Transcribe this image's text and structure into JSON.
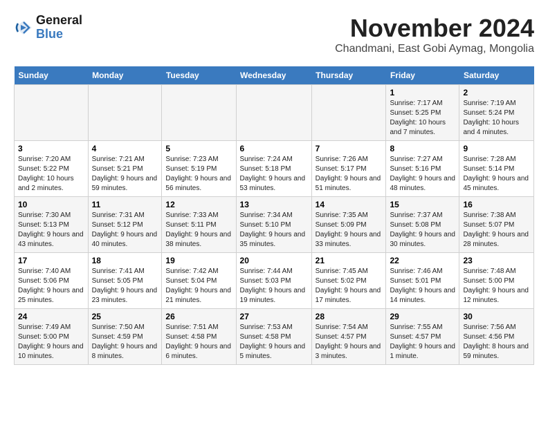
{
  "logo": {
    "line1": "General",
    "line2": "Blue"
  },
  "title": "November 2024",
  "location": "Chandmani, East Gobi Aymag, Mongolia",
  "days_of_week": [
    "Sunday",
    "Monday",
    "Tuesday",
    "Wednesday",
    "Thursday",
    "Friday",
    "Saturday"
  ],
  "weeks": [
    [
      {
        "day": "",
        "sunrise": "",
        "sunset": "",
        "daylight": ""
      },
      {
        "day": "",
        "sunrise": "",
        "sunset": "",
        "daylight": ""
      },
      {
        "day": "",
        "sunrise": "",
        "sunset": "",
        "daylight": ""
      },
      {
        "day": "",
        "sunrise": "",
        "sunset": "",
        "daylight": ""
      },
      {
        "day": "",
        "sunrise": "",
        "sunset": "",
        "daylight": ""
      },
      {
        "day": "1",
        "sunrise": "Sunrise: 7:17 AM",
        "sunset": "Sunset: 5:25 PM",
        "daylight": "Daylight: 10 hours and 7 minutes."
      },
      {
        "day": "2",
        "sunrise": "Sunrise: 7:19 AM",
        "sunset": "Sunset: 5:24 PM",
        "daylight": "Daylight: 10 hours and 4 minutes."
      }
    ],
    [
      {
        "day": "3",
        "sunrise": "Sunrise: 7:20 AM",
        "sunset": "Sunset: 5:22 PM",
        "daylight": "Daylight: 10 hours and 2 minutes."
      },
      {
        "day": "4",
        "sunrise": "Sunrise: 7:21 AM",
        "sunset": "Sunset: 5:21 PM",
        "daylight": "Daylight: 9 hours and 59 minutes."
      },
      {
        "day": "5",
        "sunrise": "Sunrise: 7:23 AM",
        "sunset": "Sunset: 5:19 PM",
        "daylight": "Daylight: 9 hours and 56 minutes."
      },
      {
        "day": "6",
        "sunrise": "Sunrise: 7:24 AM",
        "sunset": "Sunset: 5:18 PM",
        "daylight": "Daylight: 9 hours and 53 minutes."
      },
      {
        "day": "7",
        "sunrise": "Sunrise: 7:26 AM",
        "sunset": "Sunset: 5:17 PM",
        "daylight": "Daylight: 9 hours and 51 minutes."
      },
      {
        "day": "8",
        "sunrise": "Sunrise: 7:27 AM",
        "sunset": "Sunset: 5:16 PM",
        "daylight": "Daylight: 9 hours and 48 minutes."
      },
      {
        "day": "9",
        "sunrise": "Sunrise: 7:28 AM",
        "sunset": "Sunset: 5:14 PM",
        "daylight": "Daylight: 9 hours and 45 minutes."
      }
    ],
    [
      {
        "day": "10",
        "sunrise": "Sunrise: 7:30 AM",
        "sunset": "Sunset: 5:13 PM",
        "daylight": "Daylight: 9 hours and 43 minutes."
      },
      {
        "day": "11",
        "sunrise": "Sunrise: 7:31 AM",
        "sunset": "Sunset: 5:12 PM",
        "daylight": "Daylight: 9 hours and 40 minutes."
      },
      {
        "day": "12",
        "sunrise": "Sunrise: 7:33 AM",
        "sunset": "Sunset: 5:11 PM",
        "daylight": "Daylight: 9 hours and 38 minutes."
      },
      {
        "day": "13",
        "sunrise": "Sunrise: 7:34 AM",
        "sunset": "Sunset: 5:10 PM",
        "daylight": "Daylight: 9 hours and 35 minutes."
      },
      {
        "day": "14",
        "sunrise": "Sunrise: 7:35 AM",
        "sunset": "Sunset: 5:09 PM",
        "daylight": "Daylight: 9 hours and 33 minutes."
      },
      {
        "day": "15",
        "sunrise": "Sunrise: 7:37 AM",
        "sunset": "Sunset: 5:08 PM",
        "daylight": "Daylight: 9 hours and 30 minutes."
      },
      {
        "day": "16",
        "sunrise": "Sunrise: 7:38 AM",
        "sunset": "Sunset: 5:07 PM",
        "daylight": "Daylight: 9 hours and 28 minutes."
      }
    ],
    [
      {
        "day": "17",
        "sunrise": "Sunrise: 7:40 AM",
        "sunset": "Sunset: 5:06 PM",
        "daylight": "Daylight: 9 hours and 25 minutes."
      },
      {
        "day": "18",
        "sunrise": "Sunrise: 7:41 AM",
        "sunset": "Sunset: 5:05 PM",
        "daylight": "Daylight: 9 hours and 23 minutes."
      },
      {
        "day": "19",
        "sunrise": "Sunrise: 7:42 AM",
        "sunset": "Sunset: 5:04 PM",
        "daylight": "Daylight: 9 hours and 21 minutes."
      },
      {
        "day": "20",
        "sunrise": "Sunrise: 7:44 AM",
        "sunset": "Sunset: 5:03 PM",
        "daylight": "Daylight: 9 hours and 19 minutes."
      },
      {
        "day": "21",
        "sunrise": "Sunrise: 7:45 AM",
        "sunset": "Sunset: 5:02 PM",
        "daylight": "Daylight: 9 hours and 17 minutes."
      },
      {
        "day": "22",
        "sunrise": "Sunrise: 7:46 AM",
        "sunset": "Sunset: 5:01 PM",
        "daylight": "Daylight: 9 hours and 14 minutes."
      },
      {
        "day": "23",
        "sunrise": "Sunrise: 7:48 AM",
        "sunset": "Sunset: 5:00 PM",
        "daylight": "Daylight: 9 hours and 12 minutes."
      }
    ],
    [
      {
        "day": "24",
        "sunrise": "Sunrise: 7:49 AM",
        "sunset": "Sunset: 5:00 PM",
        "daylight": "Daylight: 9 hours and 10 minutes."
      },
      {
        "day": "25",
        "sunrise": "Sunrise: 7:50 AM",
        "sunset": "Sunset: 4:59 PM",
        "daylight": "Daylight: 9 hours and 8 minutes."
      },
      {
        "day": "26",
        "sunrise": "Sunrise: 7:51 AM",
        "sunset": "Sunset: 4:58 PM",
        "daylight": "Daylight: 9 hours and 6 minutes."
      },
      {
        "day": "27",
        "sunrise": "Sunrise: 7:53 AM",
        "sunset": "Sunset: 4:58 PM",
        "daylight": "Daylight: 9 hours and 5 minutes."
      },
      {
        "day": "28",
        "sunrise": "Sunrise: 7:54 AM",
        "sunset": "Sunset: 4:57 PM",
        "daylight": "Daylight: 9 hours and 3 minutes."
      },
      {
        "day": "29",
        "sunrise": "Sunrise: 7:55 AM",
        "sunset": "Sunset: 4:57 PM",
        "daylight": "Daylight: 9 hours and 1 minute."
      },
      {
        "day": "30",
        "sunrise": "Sunrise: 7:56 AM",
        "sunset": "Sunset: 4:56 PM",
        "daylight": "Daylight: 8 hours and 59 minutes."
      }
    ]
  ]
}
